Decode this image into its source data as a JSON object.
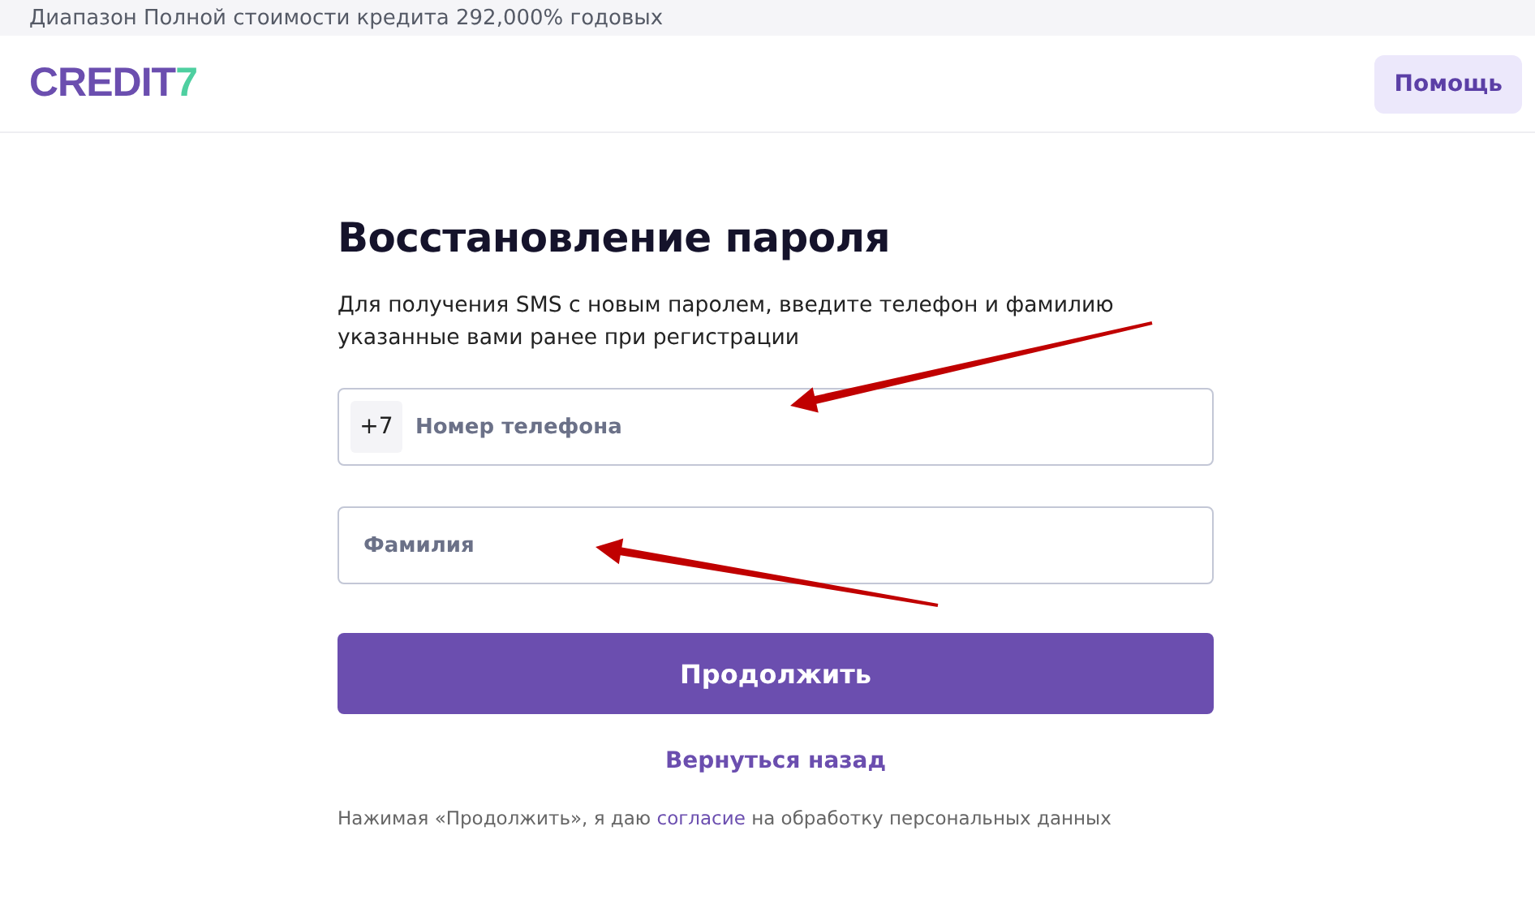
{
  "banner": {
    "text": "Диапазон Полной стоимости кредита 292,000% годовых"
  },
  "header": {
    "logo": {
      "word": "CREDIT",
      "digit": "7"
    },
    "help_button": "Помощь"
  },
  "form": {
    "title": "Восстановление пароля",
    "description": "Для получения SMS с новым паролем, введите телефон и фамилию указанные вами ранее при регистрации",
    "phone_field": {
      "prefix": "+7",
      "placeholder": "Номер телефона"
    },
    "surname_field": {
      "placeholder": "Фамилия"
    },
    "submit_button": "Продолжить",
    "back_link": "Вернуться назад",
    "consent": {
      "before": "Нажимая «Продолжить», я даю",
      "link": "согласие",
      "after": "на обработку персональных данных"
    }
  },
  "annotations": [
    {
      "kind": "arrow"
    },
    {
      "kind": "arrow"
    }
  ]
}
